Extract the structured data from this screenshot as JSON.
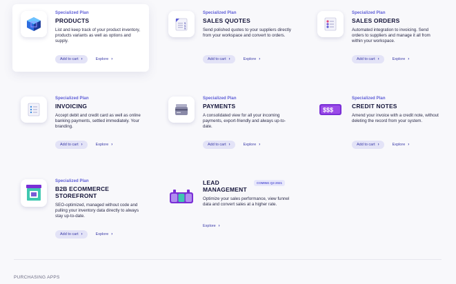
{
  "cards": [
    {
      "eyebrow": "Specialized Plan",
      "title": "PRODUCTS",
      "description": "List and keep track of your product inventory, products variants as well as options and supply.",
      "cart_label": "Add to cart",
      "explore_label": "Explore",
      "icon": "cube-icon"
    },
    {
      "eyebrow": "Specialized Plan",
      "title": "SALES QUOTES",
      "description": "Send polished quotes to your suppliers directly from your workspace and convert to orders.",
      "cart_label": "Add to cart",
      "explore_label": "Explore",
      "icon": "quote-document-icon"
    },
    {
      "eyebrow": "Specialized Plan",
      "title": "SALES ORDERS",
      "description": "Automated integration to invoicing. Send orders to suppliers and manage it all from within your workspace.",
      "cart_label": "Add to cart",
      "explore_label": "Explore",
      "icon": "order-list-icon"
    },
    {
      "eyebrow": "Specialized Plan",
      "title": "INVOICING",
      "description": "Accept debit and credit card as well as online banking payments, settled immediately. Your branding.",
      "cart_label": "Add to cart",
      "explore_label": "Explore",
      "icon": "invoice-icon"
    },
    {
      "eyebrow": "Specialized Plan",
      "title": "PAYMENTS",
      "description": "A consolidated view for all your incoming payments, export-friendly and always up-to-date.",
      "cart_label": "Add to cart",
      "explore_label": "Explore",
      "icon": "payment-card-icon"
    },
    {
      "eyebrow": "Specialized Plan",
      "title": "CREDIT NOTES",
      "description": "Amend your invoice with a credit note, without deleting the record from your system.",
      "cart_label": "Add to cart",
      "explore_label": "Explore",
      "icon": "dollar-notes-icon"
    },
    {
      "eyebrow": "Specialized Plan",
      "title": "B2B ECOMMERCE STOREFRONT",
      "description": "SEO-optimized, managed without code and pulling your inventory data directly to always stay up-to-date.",
      "cart_label": "Add to cart",
      "explore_label": "Explore",
      "icon": "storefront-icon"
    },
    {
      "eyebrow": "",
      "title": "LEAD MANAGEMENT",
      "badge": "COMING Q3 2021",
      "description": "Optimize your sales performance, view funnel data and convert sales at a higher rate.",
      "explore_label": "Explore",
      "icon": "lead-funnel-icon"
    }
  ],
  "section_label": "PURCHASING APPS",
  "colors": {
    "accent": "#5b5bd6",
    "button_bg": "#e3e3f7",
    "title": "#15153a"
  }
}
